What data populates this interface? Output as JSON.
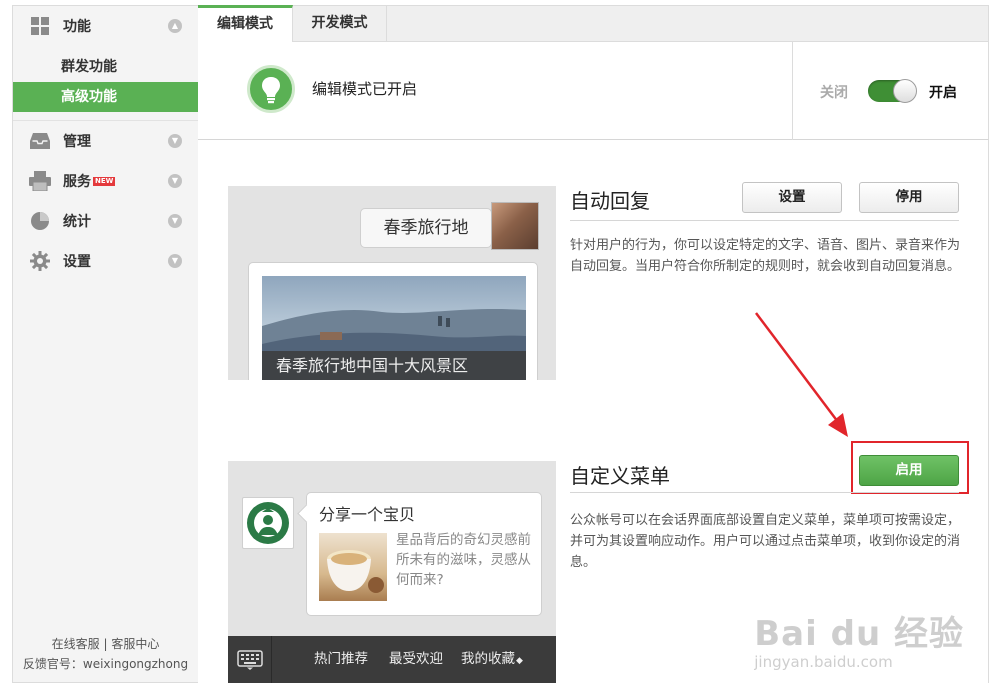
{
  "sidebar": {
    "sections": [
      {
        "label": "功能",
        "icon": "grid-icon"
      },
      {
        "label": "管理",
        "icon": "inbox-icon"
      },
      {
        "label": "服务",
        "icon": "printer-icon",
        "badge": "NEW"
      },
      {
        "label": "统计",
        "icon": "pie-chart-icon"
      },
      {
        "label": "设置",
        "icon": "gear-icon"
      }
    ],
    "sub_items": [
      {
        "label": "群发功能"
      },
      {
        "label": "高级功能",
        "active": true
      }
    ],
    "footer": {
      "service_online": "在线客服",
      "separator": "|",
      "service_center": "客服中心",
      "feedback": "反馈官号：weixingongzhong"
    }
  },
  "tabs": [
    {
      "label": "编辑模式",
      "active": true
    },
    {
      "label": "开发模式",
      "active": false
    }
  ],
  "banner": {
    "status_text": "编辑模式已开启",
    "off_label": "关闭",
    "on_label": "开启",
    "toggle_on": true
  },
  "auto_reply": {
    "title": "自动回复",
    "settings_button": "设置",
    "disable_button": "停用",
    "description": "针对用户的行为，你可以设定特定的文字、语音、图片、录音来作为自动回复。当用户符合你所制定的规则时，就会收到自动回复消息。",
    "preview": {
      "user_message": "春季旅行地",
      "news_caption": "春季旅行地中国十大风景区"
    }
  },
  "custom_menu": {
    "title": "自定义菜单",
    "enable_button": "启用",
    "description": "公众帐号可以在会话界面底部设置自定义菜单，菜单项可按需设定，并可为其设置响应动作。用户可以通过点击菜单项，收到你设定的消息。",
    "preview": {
      "share_title": "分享一个宝贝",
      "share_desc": "星品背后的奇幻灵感前所未有的滋味，灵感从何而来?",
      "menu_items": [
        "热门推荐",
        "最受欢迎",
        "我的收藏"
      ]
    }
  },
  "watermark": {
    "main": "Bai du 经验",
    "sub": "jingyan.baidu.com"
  },
  "colors": {
    "accent_green": "#5ab154",
    "highlight_red": "#e1252b"
  }
}
